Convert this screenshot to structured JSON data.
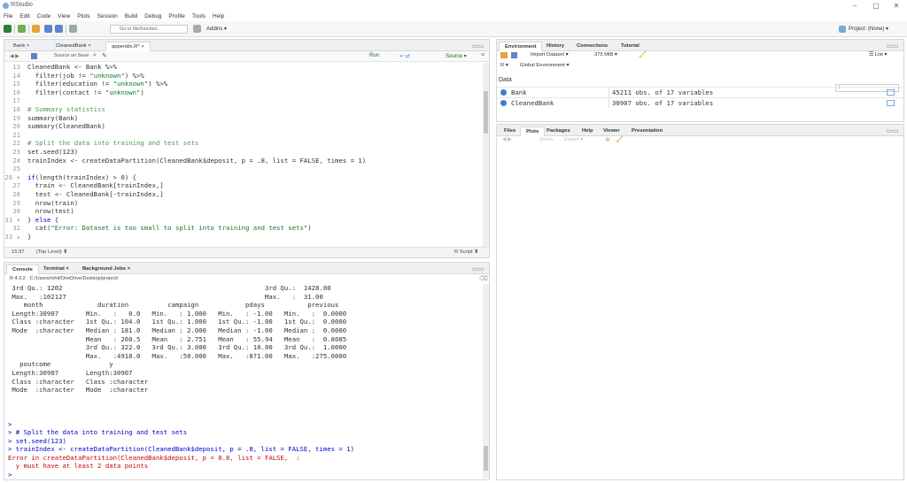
{
  "window": {
    "title": "RStudio",
    "controls": [
      "–",
      "▢",
      "✕"
    ]
  },
  "menu": [
    "File",
    "Edit",
    "Code",
    "View",
    "Plots",
    "Session",
    "Build",
    "Debug",
    "Profile",
    "Tools",
    "Help"
  ],
  "toolbar": {
    "goto_placeholder": "Go to file/function",
    "addins_label": "Addins ▾",
    "project_label": "Project: (None) ▾"
  },
  "editor": {
    "tabs": [
      {
        "label": "Bank ×"
      },
      {
        "label": "CleanedBank ×"
      },
      {
        "label": "appendix.R* ×"
      }
    ],
    "toolbar": {
      "source_on_save": "Source on Save",
      "run": "Run",
      "source": "Source ▾"
    },
    "lines": [
      {
        "num": "13",
        "parts": [
          {
            "t": "CleanedBank <- Bank %>%",
            "c": ""
          }
        ]
      },
      {
        "num": "14",
        "parts": [
          {
            "t": "  filter(job != ",
            "c": ""
          },
          {
            "t": "\"unknown\"",
            "c": "st"
          },
          {
            "t": ") %>%",
            "c": ""
          }
        ]
      },
      {
        "num": "15",
        "parts": [
          {
            "t": "  filter(education != ",
            "c": ""
          },
          {
            "t": "\"unknown\"",
            "c": "st"
          },
          {
            "t": ") %>%",
            "c": ""
          }
        ]
      },
      {
        "num": "16",
        "parts": [
          {
            "t": "  filter(contact != ",
            "c": ""
          },
          {
            "t": "\"unknown\"",
            "c": "st"
          },
          {
            "t": ")",
            "c": ""
          }
        ]
      },
      {
        "num": "17",
        "parts": [
          {
            "t": "",
            "c": ""
          }
        ]
      },
      {
        "num": "18",
        "parts": [
          {
            "t": "# Summary statistics",
            "c": "cm"
          }
        ]
      },
      {
        "num": "19",
        "parts": [
          {
            "t": "summary(Bank)",
            "c": ""
          }
        ]
      },
      {
        "num": "20",
        "parts": [
          {
            "t": "summary(CleanedBank)",
            "c": ""
          }
        ]
      },
      {
        "num": "21",
        "parts": [
          {
            "t": "",
            "c": ""
          }
        ]
      },
      {
        "num": "22",
        "parts": [
          {
            "t": "# Split the data into training and test sets",
            "c": "cm"
          }
        ]
      },
      {
        "num": "23",
        "parts": [
          {
            "t": "set.seed(123)",
            "c": ""
          }
        ]
      },
      {
        "num": "24",
        "parts": [
          {
            "t": "trainIndex <- createDataPartition(CleanedBank$deposit, p = .8, list = FALSE, times = 1)",
            "c": ""
          }
        ]
      },
      {
        "num": "25",
        "parts": [
          {
            "t": "",
            "c": ""
          }
        ]
      },
      {
        "num": "26 ▾",
        "parts": [
          {
            "t": "if",
            "c": "kw"
          },
          {
            "t": "(length(trainIndex) > 0) {",
            "c": ""
          }
        ]
      },
      {
        "num": "27",
        "parts": [
          {
            "t": "  train <- CleanedBank[trainIndex,]",
            "c": ""
          }
        ]
      },
      {
        "num": "28",
        "parts": [
          {
            "t": "  test <- CleanedBank[-trainIndex,]",
            "c": ""
          }
        ]
      },
      {
        "num": "29",
        "parts": [
          {
            "t": "  nrow(train)",
            "c": ""
          }
        ]
      },
      {
        "num": "30",
        "parts": [
          {
            "t": "  nrow(test)",
            "c": ""
          }
        ]
      },
      {
        "num": "31 ▾",
        "parts": [
          {
            "t": "} ",
            "c": ""
          },
          {
            "t": "else",
            "c": "kw"
          },
          {
            "t": " {",
            "c": ""
          }
        ]
      },
      {
        "num": "32",
        "parts": [
          {
            "t": "  cat(",
            "c": ""
          },
          {
            "t": "\"Error: Dataset is too small to split into training and test sets\"",
            "c": "st"
          },
          {
            "t": ")",
            "c": ""
          }
        ]
      },
      {
        "num": "33 ▴",
        "parts": [
          {
            "t": "}",
            "c": ""
          }
        ]
      }
    ],
    "status": {
      "position": "15:37",
      "scope": "(Top Level) ⬍",
      "type": "R Script ⬍"
    }
  },
  "console": {
    "tabs": [
      {
        "label": "Console"
      },
      {
        "label": "Terminal ×"
      },
      {
        "label": "Background Jobs ×"
      }
    ],
    "path": "R 4.3.2 · C:/Users/rohit/OneDrive/Desktop/project/",
    "lines": [
      {
        "t": " 3rd Qu.: 1202                                                    3rd Qu.:  1428.00",
        "c": ""
      },
      {
        "t": " Max.   :102127                                                   Max.   :  31.00",
        "c": ""
      },
      {
        "t": "    month              duration          campaign            pdays           previous",
        "c": ""
      },
      {
        "t": " Length:30907       Min.   :   0.0   Min.   : 1.000   Min.   : -1.00   Min.   :  0.0000",
        "c": ""
      },
      {
        "t": " Class :character   1st Qu.: 104.0   1st Qu.: 1.000   1st Qu.: -1.00   1st Qu.:  0.0000",
        "c": ""
      },
      {
        "t": " Mode  :character   Median : 181.0   Median : 2.000   Median : -1.00   Median :  0.0000",
        "c": ""
      },
      {
        "t": "                    Mean   : 260.5   Mean   : 2.751   Mean   : 55.94   Mean   :  0.8085",
        "c": ""
      },
      {
        "t": "                    3rd Qu.: 322.0   3rd Qu.: 3.000   3rd Qu.: 10.00   3rd Qu.:  1.0000",
        "c": ""
      },
      {
        "t": "                    Max.   :4918.0   Max.   :50.000   Max.   :871.00   Max.   :275.0000",
        "c": ""
      },
      {
        "t": "   poutcome               y",
        "c": ""
      },
      {
        "t": " Length:30907       Length:30907",
        "c": ""
      },
      {
        "t": " Class :character   Class :character",
        "c": ""
      },
      {
        "t": " Mode  :character   Mode  :character",
        "c": ""
      },
      {
        "t": "",
        "c": ""
      },
      {
        "t": "",
        "c": ""
      },
      {
        "t": "",
        "c": ""
      },
      {
        "t": ">",
        "c": "prompt"
      },
      {
        "t": "> # Split the data into training and test sets",
        "c": "prompt"
      },
      {
        "t": "> set.seed(123)",
        "c": "prompt"
      },
      {
        "t": "> trainIndex <- createDataPartition(CleanedBank$deposit, p = .8, list = FALSE, times = 1)",
        "c": "prompt"
      },
      {
        "t": "Error in createDataPartition(CleanedBank$deposit, p = 0.8, list = FALSE,  :",
        "c": "err"
      },
      {
        "t": "  y must have at least 2 data points",
        "c": "err"
      },
      {
        "t": ">",
        "c": "prompt"
      }
    ]
  },
  "environment": {
    "tabs": [
      {
        "label": "Environment"
      },
      {
        "label": "History"
      },
      {
        "label": "Connections"
      },
      {
        "label": "Tutorial"
      }
    ],
    "toolbar": {
      "import_label": "Import Dataset ▾",
      "memory": "375 MiB ▾",
      "list_label": "☰ List ▾"
    },
    "scope_label": "Global Environment ▾",
    "section": "Data",
    "rows": [
      {
        "name": "Bank",
        "value": "45211 obs. of 17 variables"
      },
      {
        "name": "CleanedBank",
        "value": "30907 obs. of 17 variables"
      }
    ]
  },
  "files": {
    "tabs": [
      {
        "label": "Files"
      },
      {
        "label": "Plots"
      },
      {
        "label": "Packages"
      },
      {
        "label": "Help"
      },
      {
        "label": "Viewer"
      },
      {
        "label": "Presentation"
      }
    ],
    "toolbar": {
      "zoom": "Zoom",
      "export": "Export ▾"
    }
  },
  "colors": {
    "accent": "#75aadb",
    "error": "#c5060b",
    "prompt": "#0000cc"
  }
}
